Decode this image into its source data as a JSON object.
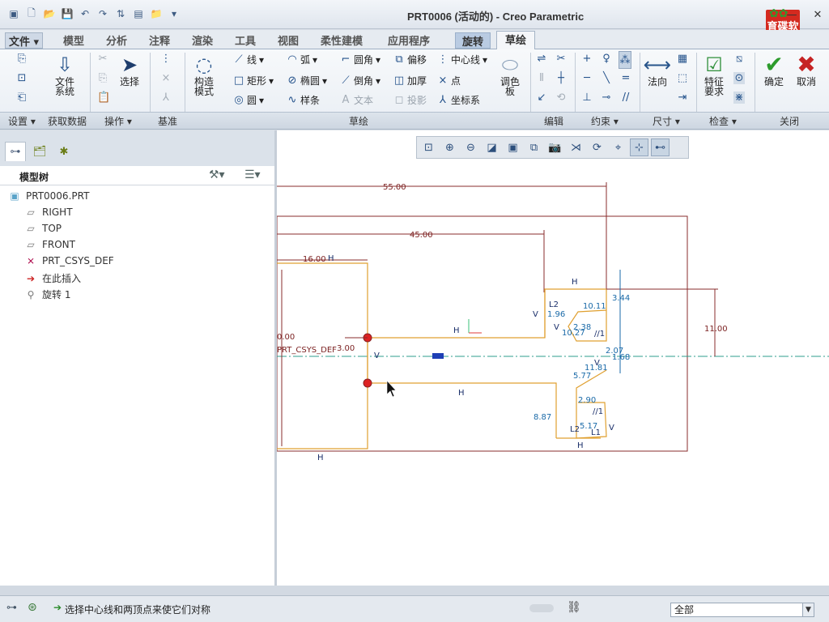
{
  "window": {
    "title": "PRT0006 (活动的) - Creo Parametric",
    "logo_text": "育碟软件"
  },
  "menu_tabs": {
    "file": "文件",
    "model": "模型",
    "analysis": "分析",
    "annotate": "注释",
    "render": "渲染",
    "tools": "工具",
    "view": "视图",
    "flexible": "柔性建模",
    "apps": "应用程序",
    "revolve": "旋转",
    "sketch": "草绘"
  },
  "ribbon": {
    "file_system": "文件系统",
    "select": "选择",
    "construct_mode": "构造模式",
    "line": "线",
    "arc": "弧",
    "fillet": "圆角",
    "offset": "偏移",
    "centerline": "中心线",
    "rectangle": "矩形",
    "ellipse": "椭圆",
    "chamfer": "倒角",
    "thicken": "加厚",
    "point": "点",
    "circle": "圆",
    "spline": "样条",
    "text": "文本",
    "project": "投影",
    "coord_sys": "坐标系",
    "palette": "调色板",
    "normal": "法向",
    "feature_req": "特征要求",
    "ok": "确定",
    "cancel": "取消",
    "groups": {
      "setup": "设置",
      "get_data": "获取数据",
      "operations": "操作",
      "datum": "基准",
      "sketching": "草绘",
      "editing": "编辑",
      "constrain": "约束",
      "dimension": "尺寸",
      "inspect": "检查",
      "close": "关闭"
    }
  },
  "model_tree": {
    "header": "模型树",
    "items": [
      {
        "label": "PRT0006.PRT"
      },
      {
        "label": "RIGHT"
      },
      {
        "label": "TOP"
      },
      {
        "label": "FRONT"
      },
      {
        "label": "PRT_CSYS_DEF"
      },
      {
        "label": "在此插入"
      },
      {
        "label": "旋转 1"
      }
    ]
  },
  "sketch": {
    "dims": {
      "d55": "55.00",
      "d45": "45.00",
      "d16": "16.00",
      "d11": "11.00",
      "d3": "3.00",
      "d0": "0.00",
      "d344": "3.44",
      "d196": "1.96",
      "d1011": "10.11",
      "d1027": "10.27",
      "d238": "2.38",
      "d207": "2.07",
      "d168": "1.68",
      "d1181": "11.81",
      "d577": "5.77",
      "d290": "2.90",
      "d517": "5.17",
      "d887": "8.87"
    },
    "csys_label": "PRT_CSYS_DEF",
    "h": "H",
    "v": "V",
    "l1": "L1",
    "l2": "L2",
    "perp": "//1"
  },
  "status": {
    "message": "选择中心线和两顶点来使它们对称",
    "filter": "全部"
  }
}
